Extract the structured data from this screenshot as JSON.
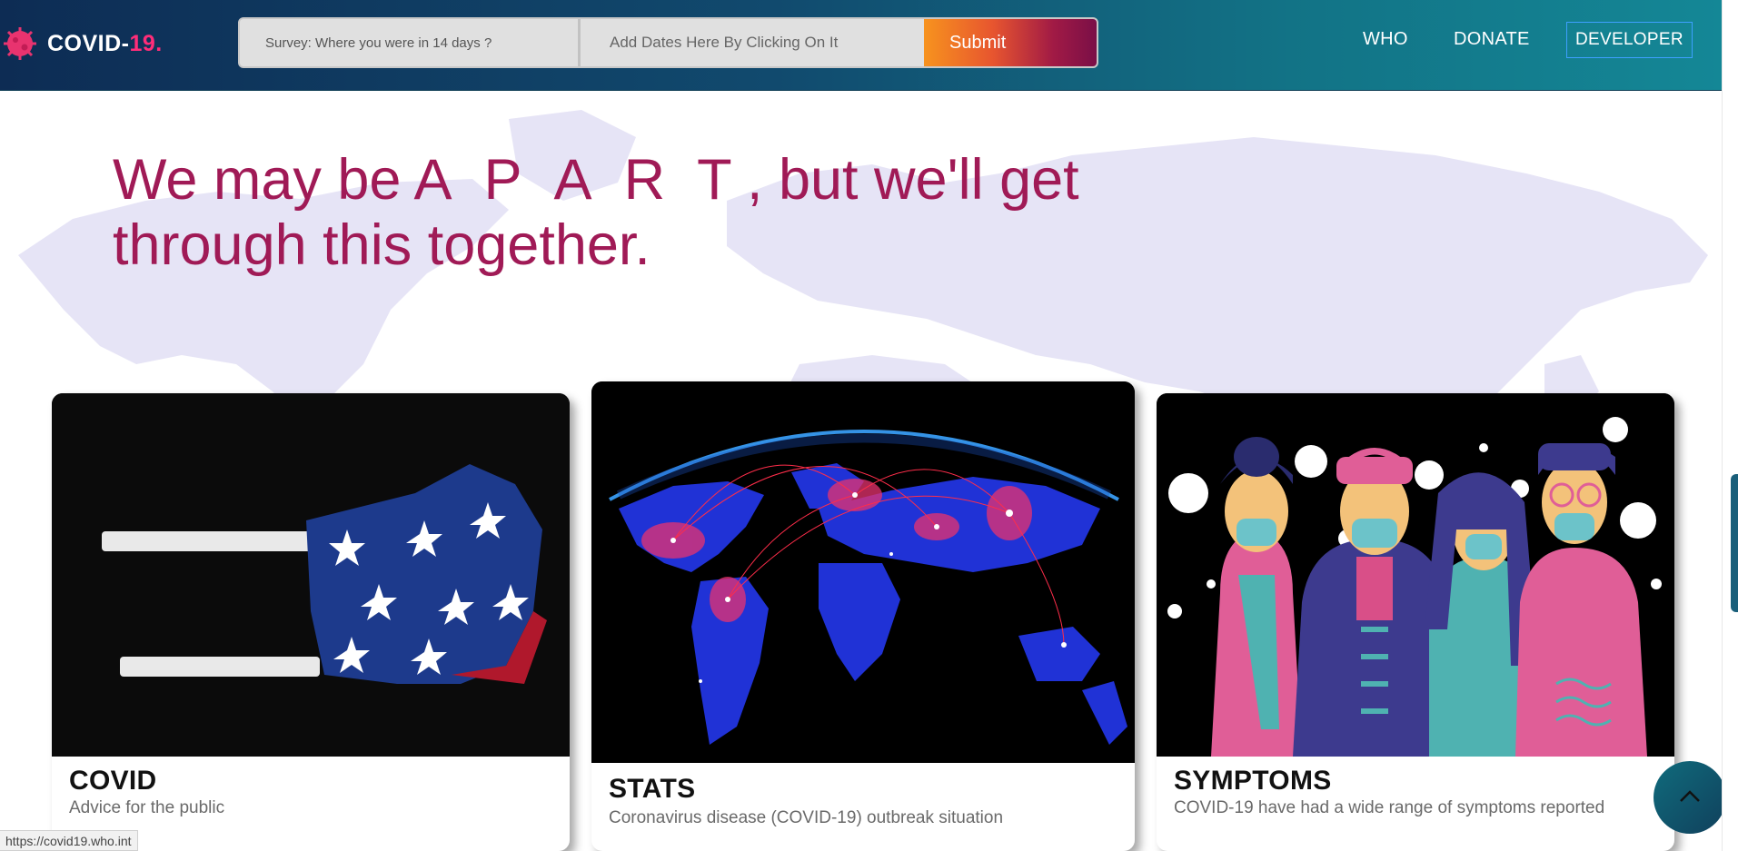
{
  "brand": {
    "name": "COVID-",
    "accent": "19.",
    "accent_color": "#ff2d79"
  },
  "survey": {
    "placeholder": "Survey:  Where you were in 14 days ?",
    "dates_placeholder": "Add Dates Here By Clicking On It",
    "submit_label": "Submit"
  },
  "nav": {
    "who": "WHO",
    "donate": "DONATE",
    "developer": "DEVELOPER"
  },
  "headline": {
    "part1": "We may be ",
    "apart": "A P A R T",
    "part2": " , but we'll get",
    "line2": "through this together.",
    "color": "#a01a56"
  },
  "cards": [
    {
      "title": "COVID",
      "subtitle": "Advice for the public",
      "image": "flag-face-mask"
    },
    {
      "title": "STATS",
      "subtitle": "Coronavirus disease (COVID-19) outbreak situation",
      "image": "glowing-world-map"
    },
    {
      "title": "SYMPTOMS",
      "subtitle": "COVID-19 have had a wide range of symptoms reported",
      "image": "people-wearing-masks"
    }
  ],
  "status_bar": {
    "url": "https://covid19.who.int"
  },
  "icons": {
    "brand": "virus-icon",
    "back_to_top": "chevron-up-icon"
  }
}
